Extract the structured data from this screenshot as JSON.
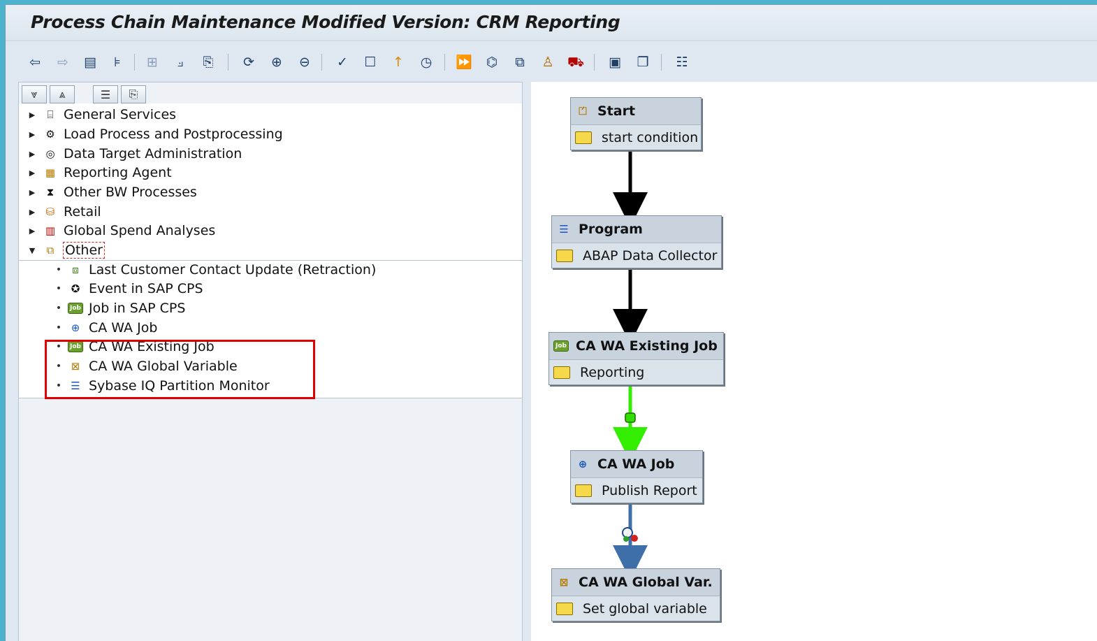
{
  "window": {
    "title": "Process Chain Maintenance Modified Version: CRM Reporting"
  },
  "toolbar": {
    "icons": [
      "back-arrow-icon",
      "forward-arrow-icon",
      "planning-view-icon",
      "tree-icon",
      "grid-icon",
      "network-icon",
      "scroll-icon",
      "refresh-icon",
      "zoom-in-icon",
      "zoom-out-icon",
      "check-icon",
      "new-document-icon",
      "pin-icon",
      "clock-icon",
      "activate-icon",
      "tree-structure-icon",
      "layout-icon",
      "person-icon",
      "transport-icon",
      "display-icon",
      "copy-icon",
      "settings-list-icon"
    ]
  },
  "tree": {
    "nodes": [
      {
        "label": "General Services",
        "icon": "general-services-icon",
        "expanded": false
      },
      {
        "label": "Load Process and Postprocessing",
        "icon": "load-process-icon",
        "expanded": false
      },
      {
        "label": "Data Target Administration",
        "icon": "data-target-icon",
        "expanded": false
      },
      {
        "label": "Reporting Agent",
        "icon": "reporting-agent-icon",
        "expanded": false
      },
      {
        "label": "Other BW Processes",
        "icon": "other-bw-icon",
        "expanded": false
      },
      {
        "label": "Retail",
        "icon": "retail-icon",
        "expanded": false
      },
      {
        "label": "Global Spend Analyses",
        "icon": "global-spend-icon",
        "expanded": false
      },
      {
        "label": "Other",
        "icon": "other-icon",
        "expanded": true
      }
    ],
    "children": [
      {
        "label": "Last Customer Contact Update (Retraction)",
        "icon": "retraction-icon"
      },
      {
        "label": "Event in SAP CPS",
        "icon": "event-icon"
      },
      {
        "label": "Job in SAP CPS",
        "icon": "job-icon",
        "badge": "Job"
      },
      {
        "label": "CA WA Job",
        "icon": "ca-wa-job-icon"
      },
      {
        "label": "CA WA Existing Job",
        "icon": "existing-job-icon",
        "badge": "Job"
      },
      {
        "label": "CA WA Global Variable",
        "icon": "global-variable-icon"
      },
      {
        "label": "Sybase IQ Partition Monitor",
        "icon": "partition-monitor-icon"
      }
    ]
  },
  "chain": {
    "processes": [
      {
        "type": "Start",
        "variant": "start condition"
      },
      {
        "type": "Program",
        "variant": "ABAP Data Collector"
      },
      {
        "type": "CA WA Existing Job",
        "variant": "Reporting",
        "badge": "Job"
      },
      {
        "type": "CA WA Job",
        "variant": "Publish Report"
      },
      {
        "type": "CA WA Global Var.",
        "variant": "Set global variable"
      }
    ],
    "links": [
      {
        "from": "Start",
        "to": "Program",
        "kind": "always",
        "color": "#000000"
      },
      {
        "from": "Program",
        "to": "CA WA Existing Job",
        "kind": "always",
        "color": "#000000"
      },
      {
        "from": "CA WA Existing Job",
        "to": "CA WA Job",
        "kind": "success",
        "color": "#33ee00"
      },
      {
        "from": "CA WA Job",
        "to": "CA WA Global Var.",
        "kind": "status",
        "color": "#3f6fa8"
      }
    ]
  },
  "colors": {
    "highlight": "#e00000",
    "background": "#4db3cc"
  }
}
